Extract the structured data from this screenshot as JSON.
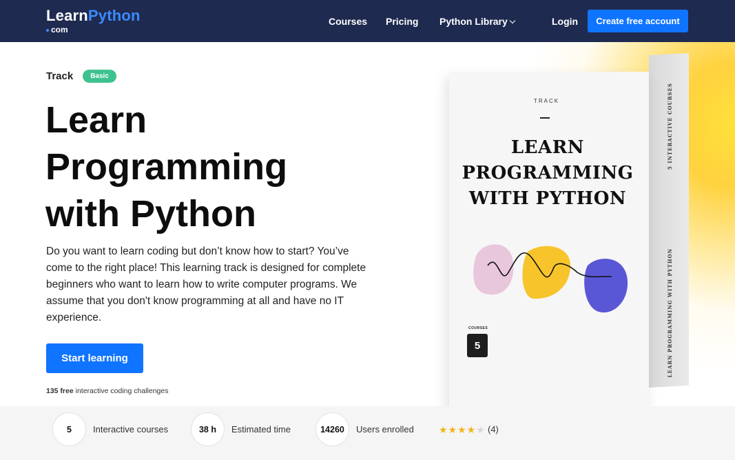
{
  "nav": {
    "logo_main_left": "Learn",
    "logo_main_right": "Python",
    "logo_sub": "com",
    "links": [
      "Courses",
      "Pricing",
      "Python Library",
      "Login"
    ],
    "cta": "Create free account"
  },
  "hero": {
    "track_label": "Track",
    "badge": "Basic",
    "title_line1": "Learn",
    "title_line2": "Programming",
    "title_line3": "with Python",
    "description": "Do you want to learn coding but don’t know how to start? You’ve come to the right place! This learning track is designed for complete beginners who want to learn how to write computer programs. We assume that you don't know programming at all and have no IT experience.",
    "start_button": "Start learning",
    "free_count": "135 free",
    "free_rest": "interactive coding challenges"
  },
  "box": {
    "track": "TRACK",
    "title_line1": "LEARN",
    "title_line2": "PROGRAMMING",
    "title_line3": "WITH PYTHON",
    "courses_label": "COURSES",
    "courses_count": "5",
    "side_top": "5 INTERACTIVE COURSES",
    "side_bottom": "LEARN PROGRAMMING WITH PYTHON"
  },
  "stats": [
    {
      "value": "5",
      "label": "Interactive courses"
    },
    {
      "value": "38 h",
      "label": "Estimated time"
    },
    {
      "value": "14260",
      "label": "Users enrolled"
    }
  ],
  "rating": {
    "stars_filled": "★★★★",
    "stars_empty": "★",
    "count": "(4)"
  },
  "colors": {
    "nav_bg": "#1f2a50",
    "accent": "#0f74ff",
    "badge": "#3ec28f",
    "star": "#f3b316"
  }
}
